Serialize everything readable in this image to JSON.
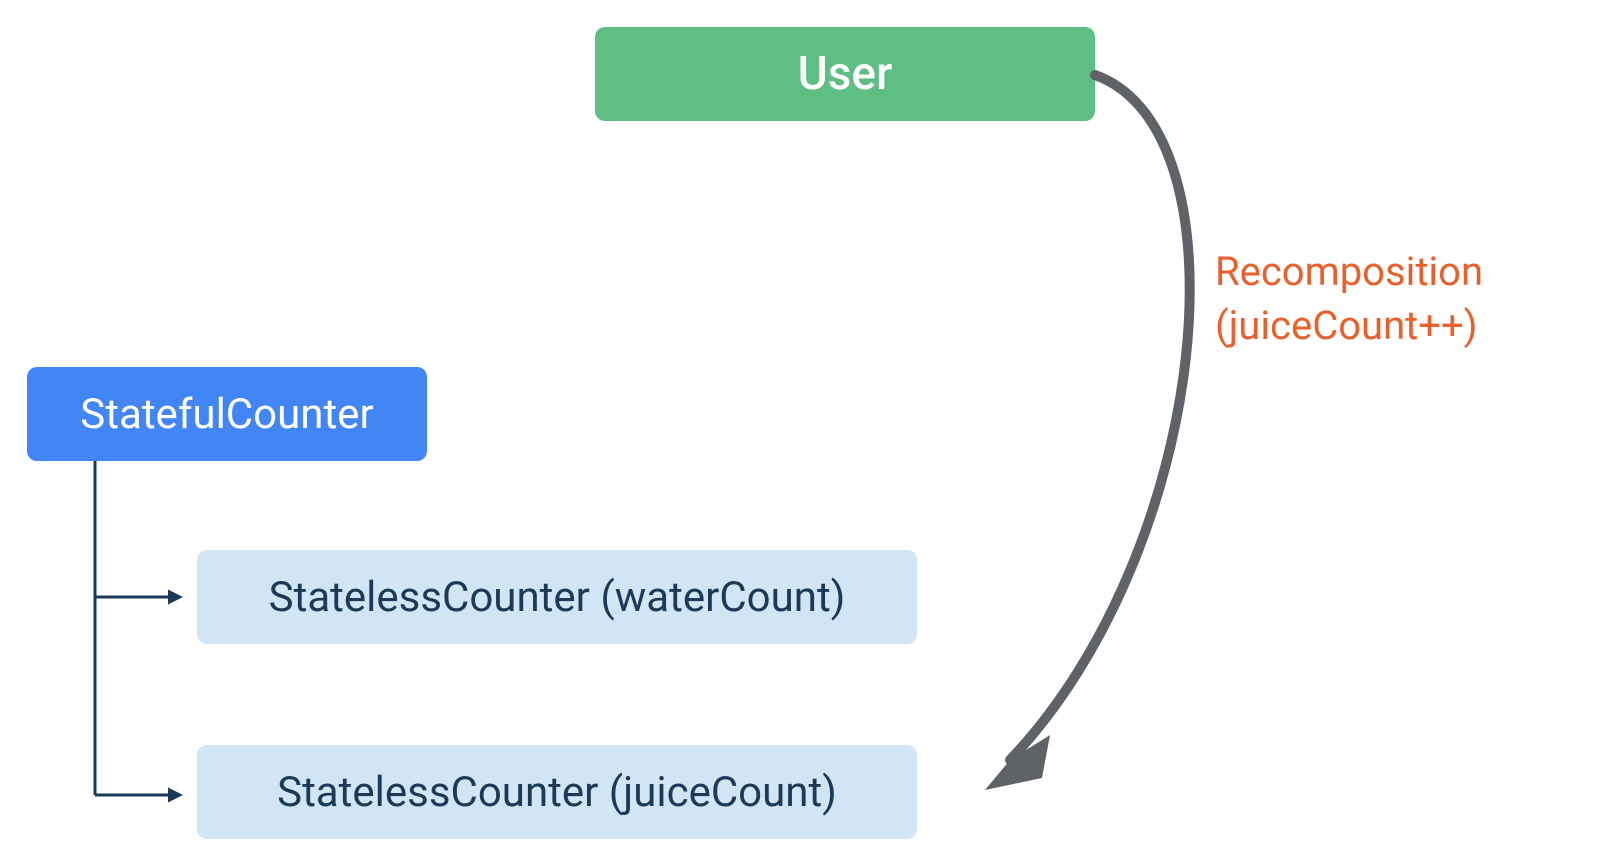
{
  "nodes": {
    "user": {
      "label": "User"
    },
    "stateful": {
      "label": "StatefulCounter"
    },
    "stateless_water": {
      "label": "StatelessCounter (waterCount)"
    },
    "stateless_juice": {
      "label": "StatelessCounter (juiceCount)"
    }
  },
  "annotation": {
    "line1": "Recomposition",
    "line2": "(juiceCount++)"
  },
  "colors": {
    "user_bg": "#5FBE84",
    "stateful_bg": "#4285F4",
    "stateless_bg": "#D2E5F4",
    "stateless_fg": "#1B3A57",
    "annotation_fg": "#E8602C",
    "arrow": "#5F6368",
    "tree_line": "#1B3A57"
  }
}
